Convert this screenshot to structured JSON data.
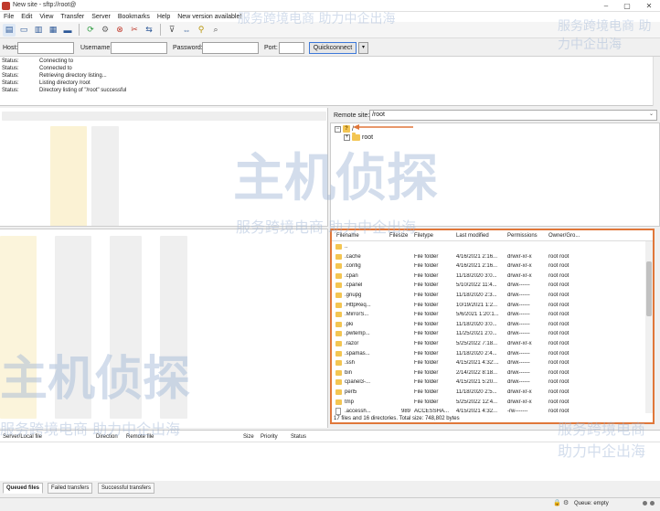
{
  "window": {
    "title": "New site - sftp://root@",
    "minimize": "–",
    "maximize": "▢",
    "close": "✕"
  },
  "menu": [
    "File",
    "Edit",
    "View",
    "Transfer",
    "Server",
    "Bookmarks",
    "Help",
    "New version available!"
  ],
  "quickconnect": {
    "host_label": "Host:",
    "username_label": "Username:",
    "password_label": "Password:",
    "port_label": "Port:",
    "button": "Quickconnect",
    "dropdown": "▾"
  },
  "message_log": [
    {
      "label": "Status:",
      "text": "Connecting to"
    },
    {
      "label": "Status:",
      "text": "Connected to"
    },
    {
      "label": "Status:",
      "text": "Retrieving directory listing..."
    },
    {
      "label": "Status:",
      "text": "Listing directory /root"
    },
    {
      "label": "Status:",
      "text": "Directory listing of \"/root\" successful"
    }
  ],
  "remote": {
    "site_label": "Remote site:",
    "site_path": "/root",
    "tree": [
      {
        "expander": "−",
        "icon": "?",
        "label": "/"
      },
      {
        "expander": "+",
        "icon": "folder",
        "label": "root"
      }
    ],
    "columns": [
      "Filename",
      "Filesize",
      "Filetype",
      "Last modified",
      "Permissions",
      "Owner/Gro..."
    ],
    "files": [
      {
        "name": "..",
        "size": "",
        "type": "",
        "modified": "",
        "perms": "",
        "owner": "",
        "kind": "folder"
      },
      {
        "name": ".cache",
        "size": "",
        "type": "File folder",
        "modified": "4/16/2021 2:16...",
        "perms": "drwxr-xr-x",
        "owner": "root root",
        "kind": "folder"
      },
      {
        "name": ".config",
        "size": "",
        "type": "File folder",
        "modified": "4/16/2021 2:16...",
        "perms": "drwxr-xr-x",
        "owner": "root root",
        "kind": "folder"
      },
      {
        "name": ".cpan",
        "size": "",
        "type": "File folder",
        "modified": "11/18/2020 3:0...",
        "perms": "drwxr-xr-x",
        "owner": "root root",
        "kind": "folder"
      },
      {
        "name": ".cpanel",
        "size": "",
        "type": "File folder",
        "modified": "5/10/2022 11:4...",
        "perms": "drwx------",
        "owner": "root root",
        "kind": "folder"
      },
      {
        "name": ".gnupg",
        "size": "",
        "type": "File folder",
        "modified": "11/18/2020 2:3...",
        "perms": "drwx------",
        "owner": "root root",
        "kind": "folder"
      },
      {
        "name": ".HttpReq...",
        "size": "",
        "type": "File folder",
        "modified": "10/19/2021 1:2...",
        "perms": "drwx------",
        "owner": "root root",
        "kind": "folder"
      },
      {
        "name": ".MirrorS...",
        "size": "",
        "type": "File folder",
        "modified": "5/6/2021 1:20:1...",
        "perms": "drwx------",
        "owner": "root root",
        "kind": "folder"
      },
      {
        "name": ".pki",
        "size": "",
        "type": "File folder",
        "modified": "11/18/2020 3:0...",
        "perms": "drwx------",
        "owner": "root root",
        "kind": "folder"
      },
      {
        "name": ".pwtemp...",
        "size": "",
        "type": "File folder",
        "modified": "11/25/2021 2:0...",
        "perms": "drwx------",
        "owner": "root root",
        "kind": "folder"
      },
      {
        "name": ".razor",
        "size": "",
        "type": "File folder",
        "modified": "5/25/2022 7:18...",
        "perms": "drwxr-xr-x",
        "owner": "root root",
        "kind": "folder"
      },
      {
        "name": ".spamas...",
        "size": "",
        "type": "File folder",
        "modified": "11/18/2020 2:4...",
        "perms": "drwx------",
        "owner": "root root",
        "kind": "folder"
      },
      {
        "name": ".ssh",
        "size": "",
        "type": "File folder",
        "modified": "4/15/2021 4:32:...",
        "perms": "drwx------",
        "owner": "root root",
        "kind": "folder"
      },
      {
        "name": "bin",
        "size": "",
        "type": "File folder",
        "modified": "2/14/2022 8:18...",
        "perms": "drwx------",
        "owner": "root root",
        "kind": "folder"
      },
      {
        "name": "cpanel3-...",
        "size": "",
        "type": "File folder",
        "modified": "4/15/2021 5:20...",
        "perms": "drwx------",
        "owner": "root root",
        "kind": "folder"
      },
      {
        "name": "perl5",
        "size": "",
        "type": "File folder",
        "modified": "11/18/2020 2:5...",
        "perms": "drwxr-xr-x",
        "owner": "root root",
        "kind": "folder"
      },
      {
        "name": "tmp",
        "size": "",
        "type": "File folder",
        "modified": "5/25/2022 12:4...",
        "perms": "drwxr-xr-x",
        "owner": "root root",
        "kind": "folder"
      },
      {
        "name": ".accessh...",
        "size": "989",
        "type": "ACCESSHA...",
        "modified": "4/15/2021 4:32...",
        "perms": "-rw-------",
        "owner": "root root",
        "kind": "file"
      }
    ],
    "summary": "17 files and 16 directories. Total size: 748,802 bytes"
  },
  "queue": {
    "columns": [
      "Server/Local file",
      "Direction",
      "Remote file",
      "Size",
      "Priority",
      "Status"
    ]
  },
  "tabs": [
    "Queued files",
    "Failed transfers",
    "Successful transfers"
  ],
  "statusbar": {
    "queue": "Queue: empty"
  },
  "watermark": {
    "brand": "主机侦探",
    "slogan": "服务跨境电商 助力中企出海"
  },
  "colors": {
    "highlight": "#e0773a",
    "folder": "#f3c552",
    "accent": "#3c78d8"
  }
}
